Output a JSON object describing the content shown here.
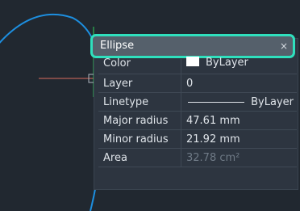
{
  "panel": {
    "title": "Ellipse",
    "close_icon": "×"
  },
  "properties": [
    {
      "label": "Color",
      "value": "ByLayer",
      "swatch_color": "#ffffff"
    },
    {
      "label": "Layer",
      "value": "0"
    },
    {
      "label": "Linetype",
      "value": "ByLayer"
    },
    {
      "label": "Major radius",
      "value": "47.61 mm"
    },
    {
      "label": "Minor radius",
      "value": "21.92 mm"
    },
    {
      "label": "Area",
      "value": "32.78 cm²"
    }
  ],
  "colors": {
    "accent": "#2fe0bd",
    "canvas_bg": "#212830",
    "ellipse": "#1d8fe0",
    "axis_green": "#2fd15a",
    "axis_red": "#d96c5e"
  }
}
